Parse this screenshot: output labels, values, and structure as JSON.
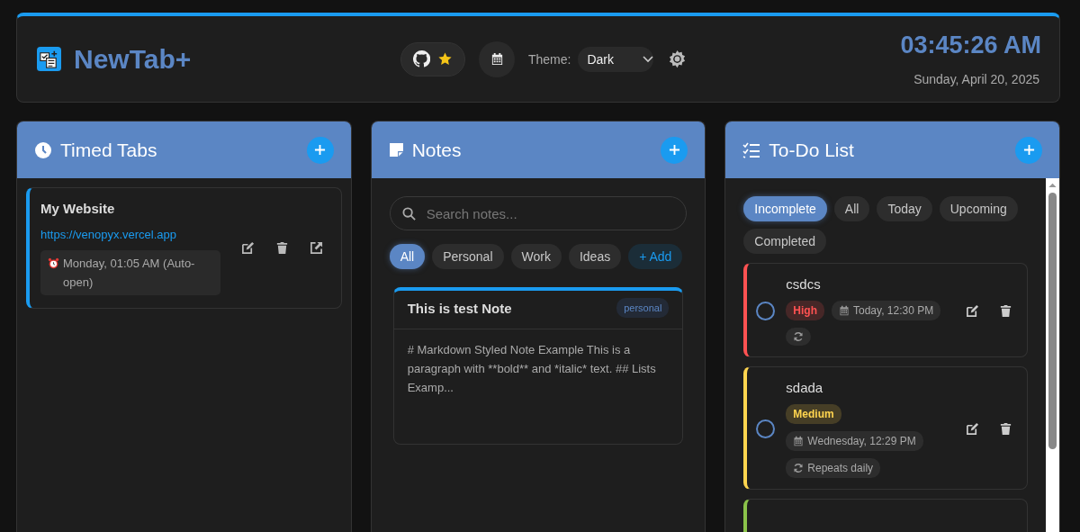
{
  "header": {
    "app_name": "NewTab+",
    "theme_label": "Theme:",
    "theme_value": "Dark",
    "time": "03:45:26 AM",
    "date": "Sunday, April 20, 2025"
  },
  "timed_tabs": {
    "title": "Timed Tabs",
    "items": [
      {
        "title": "My Website",
        "url": "https://venopyx.vercel.app",
        "schedule": "Monday, 01:05 AM (Auto-open)"
      }
    ]
  },
  "notes": {
    "title": "Notes",
    "search": {
      "placeholder": "Search notes..."
    },
    "filters": [
      {
        "label": "All",
        "selected": true
      },
      {
        "label": "Personal",
        "selected": false
      },
      {
        "label": "Work",
        "selected": false
      },
      {
        "label": "Ideas",
        "selected": false
      }
    ],
    "add_label": "+ Add",
    "items": [
      {
        "title": "This is test Note",
        "tag": "personal",
        "body": "# Markdown Styled Note Example This is a paragraph with **bold** and *italic* text. ## Lists Examp..."
      }
    ]
  },
  "todo": {
    "title": "To-Do List",
    "filters": [
      {
        "label": "Incomplete",
        "selected": true
      },
      {
        "label": "All",
        "selected": false
      },
      {
        "label": "Today",
        "selected": false
      },
      {
        "label": "Upcoming",
        "selected": false
      },
      {
        "label": "Completed",
        "selected": false
      }
    ],
    "items": [
      {
        "title": "csdcs",
        "checked": false,
        "priority": "High",
        "color": "#ff5252",
        "due": "Today, 12:30 PM",
        "repeats": true
      },
      {
        "title": "sdada",
        "checked": false,
        "priority": "Medium",
        "color": "#ffd54f",
        "due": "Wednesday, 12:29 PM",
        "repeats": true,
        "repeat_label": "Repeats daily"
      },
      {
        "color": "#8bc34a"
      }
    ]
  }
}
